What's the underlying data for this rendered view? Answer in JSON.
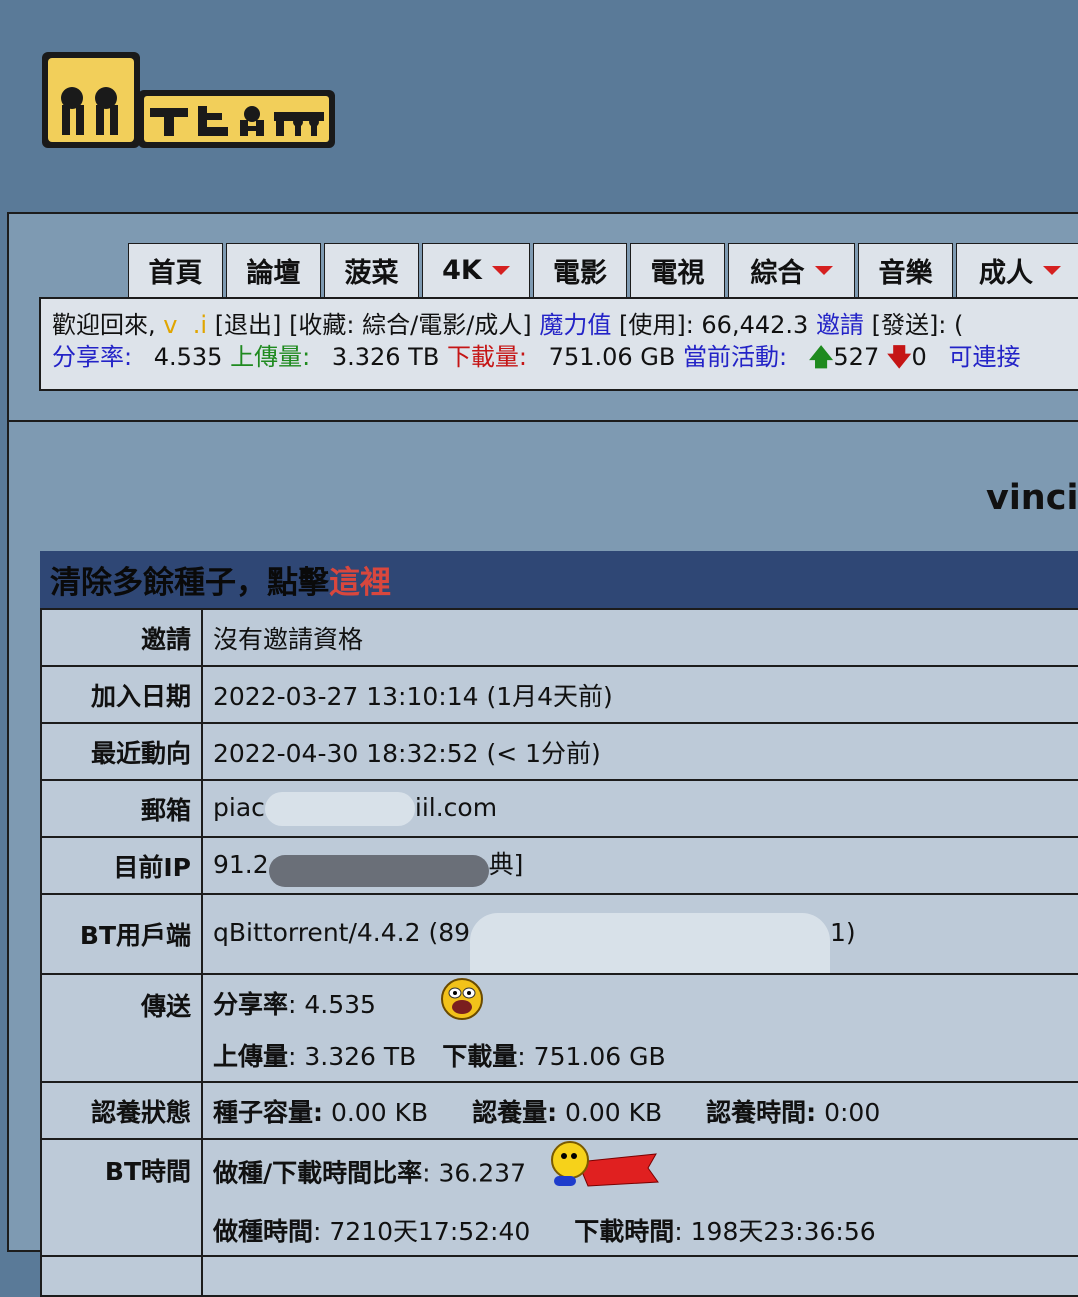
{
  "logo": {
    "text": "MTEAM"
  },
  "nav": [
    {
      "label": "首頁",
      "has_dropdown": false
    },
    {
      "label": "論壇",
      "has_dropdown": false
    },
    {
      "label": "菠菜",
      "has_dropdown": false
    },
    {
      "label": "4K",
      "has_dropdown": true
    },
    {
      "label": "電影",
      "has_dropdown": false
    },
    {
      "label": "電視",
      "has_dropdown": false
    },
    {
      "label": "綜合",
      "has_dropdown": true
    },
    {
      "label": "音樂",
      "has_dropdown": false
    },
    {
      "label": "成人",
      "has_dropdown": true
    }
  ],
  "userbar": {
    "welcome": "歡迎回來,",
    "user_short": "v  .i",
    "logout": "[退出]",
    "fav": "[收藏: 綜合/電影/成人]",
    "magic_label": "魔力值",
    "magic_value": "[使用]: 66,442.3",
    "invite": "邀請",
    "send": "[發送]: (",
    "ratio_label": "分享率:",
    "ratio_value": "4.535",
    "upload_label": "上傳量:",
    "upload_value": "3.326 TB",
    "download_label": "下載量:",
    "download_value": "751.06 GB",
    "active_label": "當前活動:",
    "seeding": "527",
    "leeching": "0",
    "connectable": "可連接"
  },
  "profile": {
    "username": "vinci"
  },
  "banner": {
    "text": "清除多餘種子，點擊",
    "link": "這裡"
  },
  "details": {
    "invite_label": "邀請",
    "invite_value": "沒有邀請資格",
    "join_label": "加入日期",
    "join_value": "2022-03-27 13:10:14 (1月4天前)",
    "recent_label": "最近動向",
    "recent_value": "2022-04-30 18:32:52 (< 1分前)",
    "email_label": "郵箱",
    "email_start": "piac",
    "email_end": "iil.com",
    "ip_label": "目前IP",
    "ip_start": "91.2",
    "ip_end": "典]",
    "client_label": "BT用戶端",
    "client_start": "qBittorrent/4.4.2 (89",
    "client_end": "1)",
    "transfer_label": "傳送",
    "ratio_k": "分享率",
    "ratio_v": ": 4.535",
    "up_k": "上傳量",
    "up_v": ": 3.326 TB",
    "down_k": "下載量",
    "down_v": ": 751.06 GB",
    "adopt_label": "認養狀態",
    "seed_size_k": "種子容量:",
    "seed_size_v": "0.00 KB",
    "adopt_amt_k": "認養量:",
    "adopt_amt_v": "0.00 KB",
    "adopt_time_k": "認養時間:",
    "adopt_time_v": "0:00",
    "bt_time_label": "BT時間",
    "seed_dl_ratio_k": "做種/下載時間比率",
    "seed_dl_ratio_v": ": 36.237",
    "seed_time_k": "做種時間",
    "seed_time_v": ": 7210天17:52:40",
    "dl_time_k": "下載時間",
    "dl_time_v": ": 198天23:36:56"
  },
  "colors": {
    "background": "#5a7a98",
    "banner": "#2f4775",
    "table": "#bdcad8",
    "link": "#2323c7"
  }
}
